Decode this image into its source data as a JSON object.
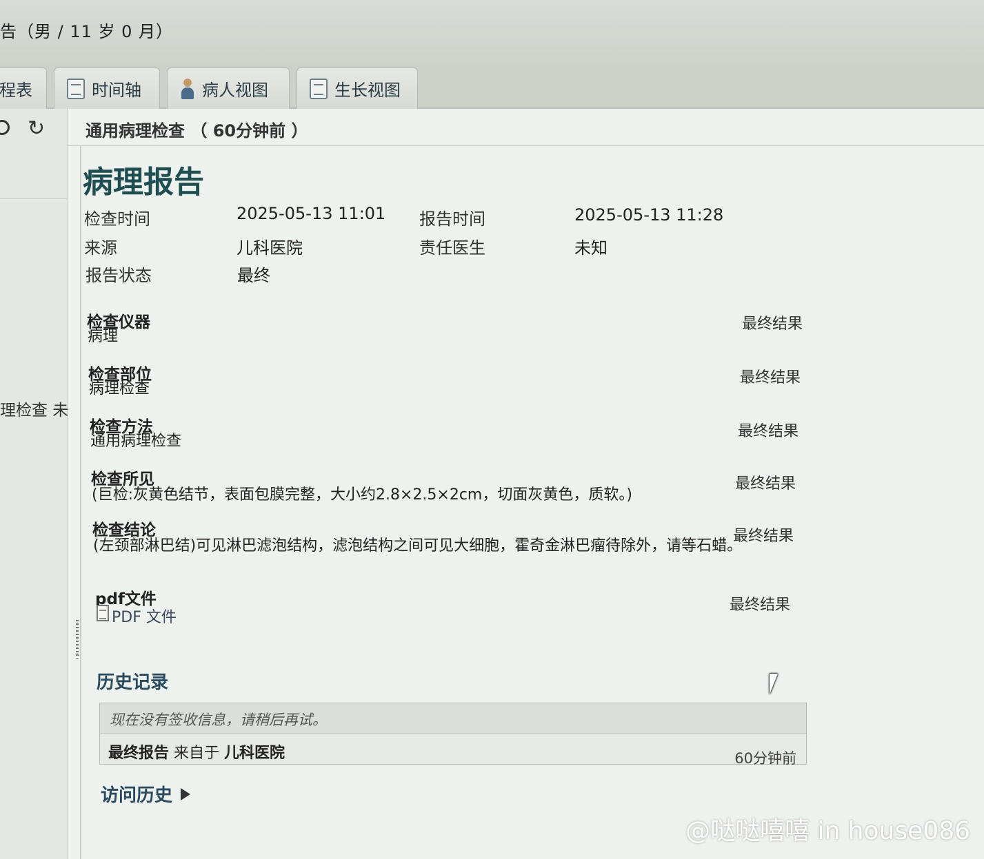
{
  "window": {
    "patient_title": "告（男 / 11 岁 0 月）"
  },
  "tabs": [
    {
      "label": "程表"
    },
    {
      "label": "时间轴"
    },
    {
      "label": "病人视图"
    },
    {
      "label": "生长视图"
    }
  ],
  "sidebar": {
    "item": "理检查 未知"
  },
  "header": {
    "title": "通用病理检查 （ 60分钟前 ）"
  },
  "report": {
    "title": "病理报告",
    "meta": {
      "exam_time_label": "检查时间",
      "exam_time_value": "2025-05-13 11:01",
      "report_time_label": "报告时间",
      "report_time_value": "2025-05-13 11:28",
      "source_label": "来源",
      "source_value": "儿科医院",
      "doctor_label": "责任医生",
      "doctor_value": "未知",
      "status_label": "报告状态",
      "status_value": "最终"
    },
    "sections": [
      {
        "label": "检查仪器",
        "value": "病理",
        "tag": "最终结果"
      },
      {
        "label": "检查部位",
        "value": "病理检查",
        "tag": "最终结果"
      },
      {
        "label": "检查方法",
        "value": "通用病理检查",
        "tag": "最终结果"
      },
      {
        "label": "检查所见",
        "value": "(巨检:灰黄色结节，表面包膜完整，大小约2.8×2.5×2cm，切面灰黄色，质软。)",
        "tag": "最终结果"
      },
      {
        "label": "检查结论",
        "value": "(左颈部淋巴结)可见淋巴滤泡结构，滤泡结构之间可见大细胞，霍奇金淋巴瘤待除外，请等石蜡。",
        "tag": "最终结果"
      },
      {
        "label": "pdf文件",
        "value": "PDF 文件",
        "tag": "最终结果"
      }
    ]
  },
  "history": {
    "title": "历史记录",
    "empty_message": "现在没有签收信息，请稍后再试。",
    "row_prefix": "最终报告",
    "row_middle": "来自于",
    "row_source": "儿科医院",
    "row_time": "60分钟前"
  },
  "visit_history": {
    "label": "访问历史"
  },
  "watermark": "@哒哒嘻嘻 in house086"
}
